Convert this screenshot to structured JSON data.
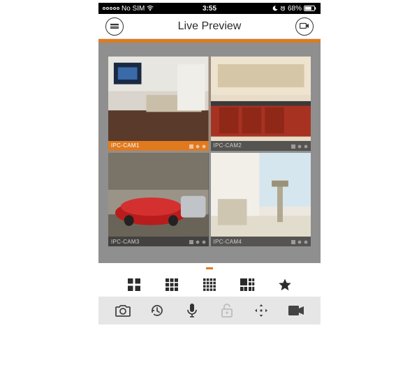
{
  "statusbar": {
    "carrier": "No SIM",
    "time": "3:55",
    "battery_pct": "68%"
  },
  "header": {
    "title": "Live Preview"
  },
  "accent_color": "#e07a1f",
  "cameras": [
    {
      "label": "IPC-CAM1",
      "selected": true
    },
    {
      "label": "IPC-CAM2",
      "selected": false
    },
    {
      "label": "IPC-CAM3",
      "selected": false
    },
    {
      "label": "IPC-CAM4",
      "selected": false
    }
  ],
  "layout_buttons": [
    {
      "name": "grid-2x2"
    },
    {
      "name": "grid-3x3"
    },
    {
      "name": "grid-4x4"
    },
    {
      "name": "grid-mixed"
    },
    {
      "name": "favorite"
    }
  ],
  "bottom_buttons": [
    {
      "name": "snapshot"
    },
    {
      "name": "history"
    },
    {
      "name": "mic"
    },
    {
      "name": "unlock"
    },
    {
      "name": "ptz"
    },
    {
      "name": "record"
    }
  ]
}
